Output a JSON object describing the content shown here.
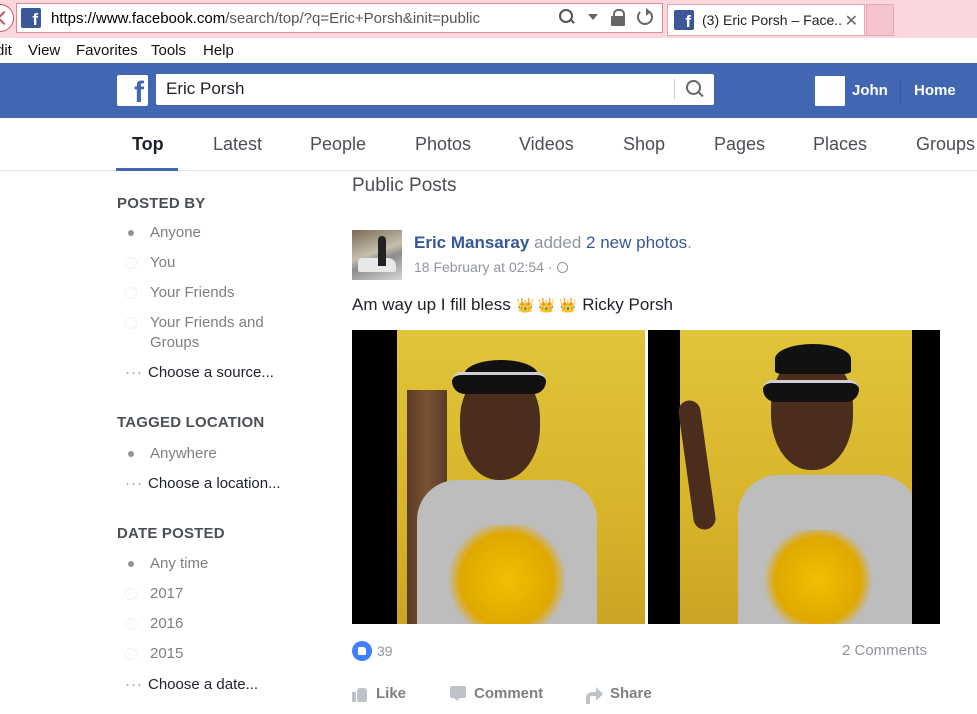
{
  "browser": {
    "url_host": "https://www.facebook.com",
    "url_path": "/search/top/?q=Eric+Porsh&init=public",
    "tab_title": "(3) Eric Porsh – Face...",
    "tab_close": "✕",
    "menu": [
      "dit",
      "View",
      "Favorites",
      "Tools",
      "Help"
    ]
  },
  "topbar": {
    "search_value": "Eric Porsh",
    "user_name": "John",
    "home_label": "Home"
  },
  "tabs": [
    "Top",
    "Latest",
    "People",
    "Photos",
    "Videos",
    "Shop",
    "Pages",
    "Places",
    "Groups"
  ],
  "filters": {
    "posted_by": {
      "heading": "POSTED BY",
      "options": [
        "Anyone",
        "You",
        "Your Friends",
        "Your Friends and",
        "Groups"
      ],
      "choose": "Choose a source..."
    },
    "tagged_location": {
      "heading": "TAGGED LOCATION",
      "options": [
        "Anywhere"
      ],
      "choose": "Choose a location..."
    },
    "date_posted": {
      "heading": "DATE POSTED",
      "options": [
        "Any time",
        "2017",
        "2016",
        "2015"
      ],
      "choose": "Choose a date..."
    },
    "dots": "···"
  },
  "results": {
    "section_title": "Public Posts",
    "post": {
      "author": "Eric Mansaray",
      "verb": " added ",
      "object": "2 new photos",
      "period": ".",
      "date": "18 February at 02:54 ·",
      "text_before": "Am way up I fill bless ",
      "crowns": "👑 👑 👑",
      "text_after": " Ricky Porsh",
      "likes_count": "39",
      "comments": "2 Comments",
      "actions": {
        "like": "Like",
        "comment": "Comment",
        "share": "Share"
      }
    }
  },
  "colors": {
    "fb_blue": "#4267b2",
    "link_blue": "#365899",
    "like_blue": "#4080ff"
  }
}
